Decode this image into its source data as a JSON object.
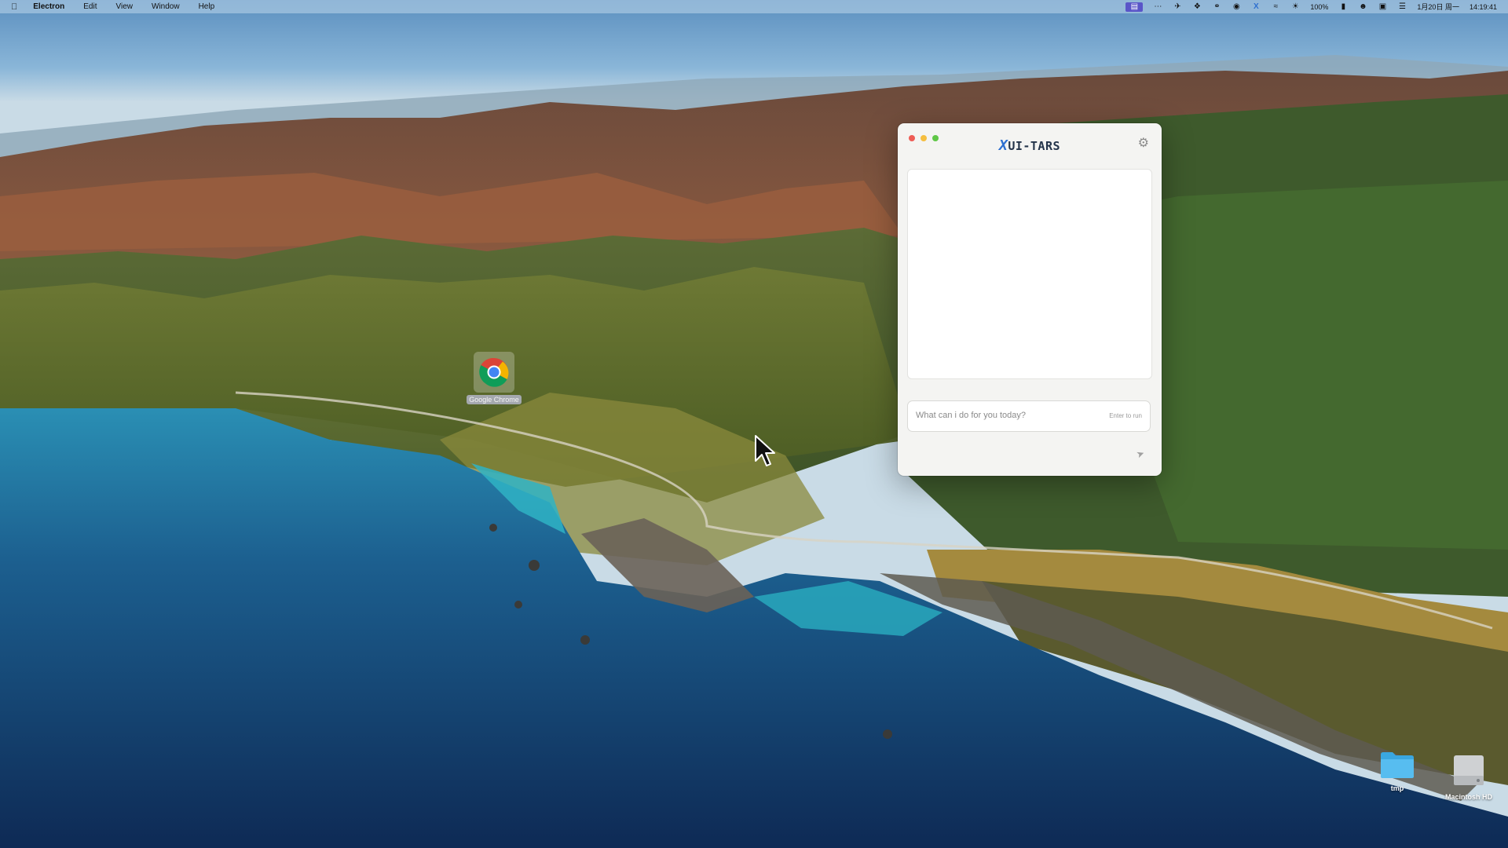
{
  "menubar": {
    "app_name": "Electron",
    "menus": [
      "Edit",
      "View",
      "Window",
      "Help"
    ],
    "battery": "100%",
    "date": "1月20日 周一",
    "time": "14:19:41"
  },
  "desktop": {
    "icons": [
      {
        "label": "Google Chrome",
        "icon": "chrome-icon"
      },
      {
        "label": "tmp",
        "icon": "folder-icon"
      },
      {
        "label": "Macintosh HD",
        "icon": "disk-icon"
      }
    ]
  },
  "window": {
    "title": "UI-TARS",
    "logo_icon": "x-logo-icon",
    "settings_icon": "gear-icon",
    "input_placeholder": "What can i do for you today?",
    "input_value": "",
    "input_hint": "Enter  to run",
    "send_icon": "send-icon"
  },
  "colors": {
    "close": "#ee5c55",
    "minimize": "#f5be3f",
    "maximize": "#5fc747",
    "accent": "#2d6fd0"
  }
}
